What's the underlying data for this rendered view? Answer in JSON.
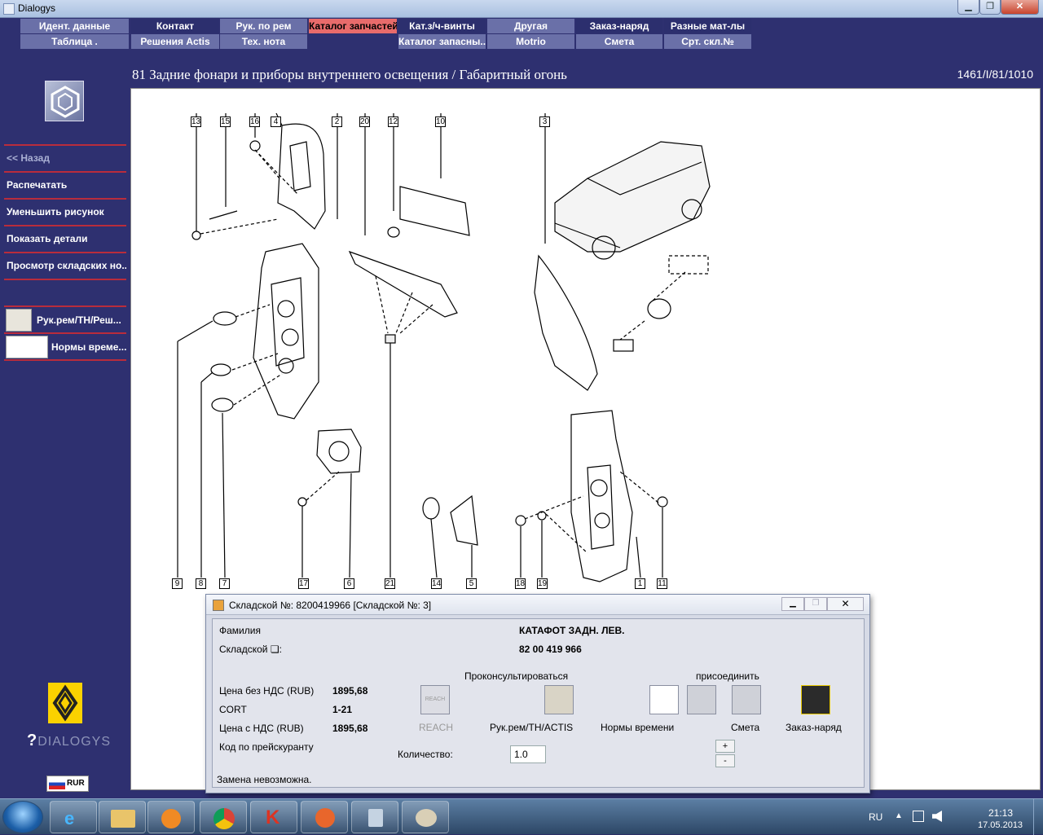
{
  "window": {
    "title": "Dialogys",
    "min": "▁",
    "max": "❐",
    "close": "✕"
  },
  "menu": {
    "row1": [
      "Идент. данные",
      "Контакт",
      "Рук. по рем",
      "Каталог запчастей",
      "Кат.з/ч-винты",
      "Другая",
      "Заказ-наряд",
      "Разные мат-лы"
    ],
    "row2": [
      "Таблица .",
      "Решения Actis",
      "Тех. нота",
      "",
      "Каталог запасны...",
      "Motrio",
      "Смета",
      "Срт. скл.№"
    ],
    "active": "Каталог запчастей"
  },
  "page": {
    "title": "81 Задние фонари и приборы внутреннего освещения / Габаритный огонь",
    "code": "1461/I/81/1010"
  },
  "sidebar": {
    "items": [
      "<< Назад",
      "Распечатать",
      "Уменьшить рисунок",
      "Показать детали",
      "Просмотр складских но..."
    ],
    "tools": [
      "Рук.рем/ТН/Реш...",
      "Нормы време..."
    ],
    "brand": "DIALOGYS",
    "currency": "RUR"
  },
  "diagram": {
    "callouts_top": [
      "13",
      "15",
      "16",
      "4",
      "2",
      "20",
      "12",
      "10",
      "3"
    ],
    "callouts_bottom": [
      "9",
      "8",
      "7",
      "17",
      "6",
      "21",
      "14",
      "5",
      "18",
      "19",
      "1",
      "11"
    ]
  },
  "dialog": {
    "title": "Складской №: 8200419966 [Складской №: 3]",
    "familia_label": "Фамилия",
    "familia_value": "КАТАФОТ ЗАДН. ЛЕВ.",
    "sklad_label": "Складской ❏:",
    "sklad_value": "82 00 419 966",
    "price_net_label": "Цена без НДС (RUB)",
    "price_net_value": "1895,68",
    "cort_label": "CORT",
    "cort_value": "1-21",
    "price_gross_label": "Цена с НДС (RUB)",
    "price_gross_value": "1895,68",
    "pricelist_label": "Код по прейскуранту",
    "consult_label": "Проконсультироваться",
    "attach_label": "присоединить",
    "reach_icon_text": "REACH",
    "reach_label": "REACH",
    "repair_label": "Рук.рем/ТН/ACTIS",
    "norms_label": "Нормы времени",
    "estimate_label": "Смета",
    "order_label": "Заказ-наряд",
    "qty_label": "Количество:",
    "qty_value": "1.0",
    "plus": "+",
    "minus": "-",
    "status": "Замена невозможна."
  },
  "taskbar": {
    "lang": "RU",
    "time": "21:13",
    "date": "17.05.2013"
  },
  "colors": {
    "active_menu": "#e86b6b",
    "menu_dark": "#2c2f6e",
    "menu_light": "#6a70a8",
    "separator": "#b92c3c"
  }
}
